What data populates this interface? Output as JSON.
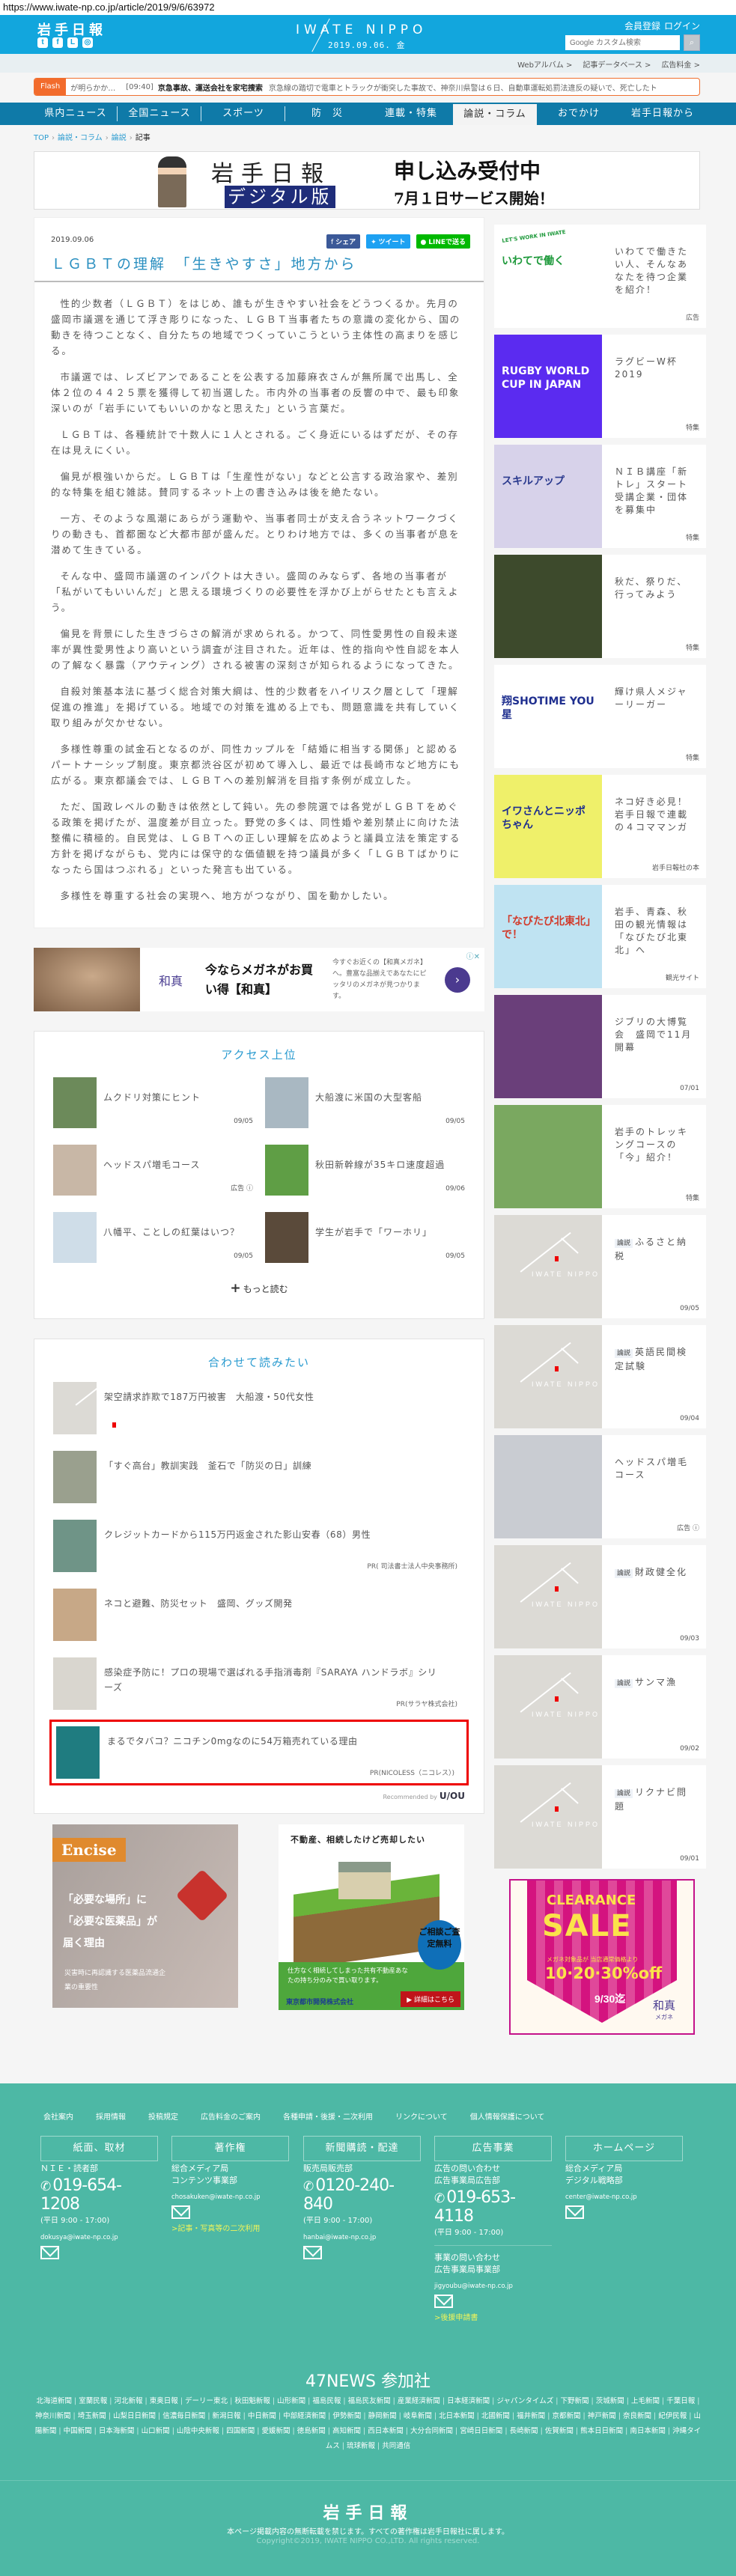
{
  "browser": {
    "url": "https://www.iwate-np.co.jp/article/2019/9/6/63972"
  },
  "header": {
    "logo": "岩手日報",
    "brand": "IWATE NIPPO",
    "date": "2019.09.06. 金",
    "register": "会員登録",
    "login": "ログイン",
    "search_placeholder": "Google カスタム検索",
    "search_icon": "magnifier",
    "social": [
      "twitter-icon",
      "facebook-icon",
      "line-icon",
      "instagram-icon"
    ],
    "sublinks": [
      "Webアルバム >",
      "記事データベース >",
      "広告料金 >"
    ]
  },
  "flash": {
    "label": "Flash",
    "prev": "が明らかか…",
    "time": "[09:40]",
    "headline": "京急事故、運送会社を家宅捜索",
    "text": "京急線の踏切で電車とトラックが衝突した事故で、神奈川県警は６日、自動車運転処罰法違反の疑いで、死亡したト"
  },
  "nav": [
    {
      "label": "県内ニュース"
    },
    {
      "label": "全国ニュース"
    },
    {
      "label": "スポーツ"
    },
    {
      "label": "防　災"
    },
    {
      "label": "連載・特集"
    },
    {
      "label": "論説・コラム",
      "active": true
    },
    {
      "label": "おでかけ"
    },
    {
      "label": "岩手日報から"
    }
  ],
  "breadcrumb": [
    "TOP",
    "論説・コラム",
    "論説",
    "記事"
  ],
  "banner": {
    "paper": "岩手日報",
    "digital": "デジタル版",
    "apply": "申し込み受付中",
    "service": "7月１日サービス開始！"
  },
  "article": {
    "date": "2019.09.06",
    "share": "シェア",
    "tweet": "ツイート",
    "line": "LINEで送る",
    "title": "ＬＧＢＴの理解　「生きやすさ」地方から",
    "paragraphs": [
      "性的少数者（ＬＧＢＴ）をはじめ、誰もが生きやすい社会をどうつくるか。先月の盛岡市議選を通じて浮き彫りになった、ＬＧＢＴ当事者たちの意識の変化から、国の動きを待つことなく、自分たちの地域でつくっていこうという主体性の高まりを感じる。",
      "市議選では、レズビアンであることを公表する加藤麻衣さんが無所属で出馬し、全体２位の４４２５票を獲得して初当選した。市内外の当事者の反響の中で、最も印象深いのが「岩手にいてもいいのかなと思えた」という言葉だ。",
      "ＬＧＢＴは、各種統計で十数人に１人とされる。ごく身近にいるはずだが、その存在は見えにくい。",
      "偏見が根強いからだ。ＬＧＢＴは「生産性がない」などと公言する政治家や、差別的な特集を組む雑誌。賛同するネット上の書き込みは後を絶たない。",
      "一方、そのような風潮にあらがう運動や、当事者同士が支え合うネットワークづくりの動きも、首都圏など大都市部が盛んだ。とりわけ地方では、多くの当事者が息を潜めて生きている。",
      "そんな中、盛岡市議選のインパクトは大きい。盛岡のみならず、各地の当事者が「私がいてもいいんだ」と思える環境づくりの必要性を浮かび上がらせたとも言えよう。",
      "偏見を背景にした生きづらさの解消が求められる。かつて、同性愛男性の自殺未遂率が異性愛男性より高いという調査が注目された。近年は、性的指向や性自認を本人の了解なく暴露（アウティング）される被害の深刻さが知られるようになってきた。",
      "自殺対策基本法に基づく総合対策大綱は、性的少数者をハイリスク層として「理解促進の推進」を掲げている。地域での対策を進める上でも、問題意識を共有していく取り組みが欠かせない。",
      "多様性尊重の試金石となるのが、同性カップルを「結婚に相当する関係」と認めるパートナーシップ制度。東京都渋谷区が初めて導入し、最近では長崎市など地方にも広がる。東京都議会では、ＬＧＢＴへの差別解消を目指す条例が成立した。",
      "ただ、国政レベルの動きは依然として鈍い。先の参院選では各党がＬＧＢＴをめぐる政策を掲げたが、温度差が目立った。野党の多くは、同性婚や差別禁止に向けた法整備に積極的。自民党は、ＬＧＢＴへの正しい理解を広めようと議員立法を策定する方針を掲げながらも、党内には保守的な価値観を持つ議員が多く「ＬＧＢＴばかりになったら国はつぶれる」といった発言も出ている。",
      "多様性を尊重する社会の実現へ、地方がつながり、国を動かしたい。"
    ]
  },
  "ad_glasses": {
    "brand": "和真",
    "headline": "今ならメガネがお買い得【和真】",
    "desc": "今すぐお近くの【和真メガネ】へ。豊富な品揃えであなたにピッタリのメガネが見つかります。",
    "go": "›",
    "adchoices": "ⓘ✕"
  },
  "ranking": {
    "title": "アクセス上位",
    "more": "もっと読む",
    "items": [
      {
        "title": "ムクドリ対策にヒント",
        "meta": "09/05",
        "thumb": "#6c8a5a"
      },
      {
        "title": "大船渡に米国の大型客船",
        "meta": "09/05",
        "thumb": "#a9b8c2"
      },
      {
        "title": "ヘッドスパ増毛コース",
        "meta": "広告 ⓘ",
        "thumb": "#c8b7a6"
      },
      {
        "title": "秋田新幹線が35キロ速度超過",
        "meta": "09/06",
        "thumb": "#5f9e45"
      },
      {
        "title": "八幡平、ことしの紅葉はいつ？",
        "meta": "09/05",
        "thumb": "#cfdde8"
      },
      {
        "title": "学生が岩手で「ワーホリ」",
        "meta": "09/05",
        "thumb": "#5a4a3a"
      }
    ]
  },
  "related": {
    "title": "合わせて読みたい",
    "recommended_by": "Recommended by",
    "recommender": "U/OU",
    "items": [
      {
        "title": "架空請求詐欺で187万円被害　大船渡・50代女性",
        "pr": "",
        "thumb": "nippo"
      },
      {
        "title": "「すぐ高台」教訓実践　釜石で「防災の日」訓練",
        "pr": "",
        "thumb": "#9aa08e"
      },
      {
        "title": "クレジットカードから115万円返金された影山安春（68）男性",
        "pr": "PR( 司法書士法人中央事務所)",
        "thumb": "#6f9487"
      },
      {
        "title": "ネコと避難、防災セット　盛岡、グッズ開発",
        "pr": "",
        "thumb": "#c7a887"
      },
      {
        "title": "感染症予防に！プロの現場で選ばれる手指消毒剤『SARAYA ハンドラボ』シリーズ",
        "pr": "PR(サラヤ株式会社)",
        "thumb": "#d9d6cf"
      },
      {
        "title": "まるでタバコ？ニコチン0mgなのに54万箱売れている理由",
        "pr": "PR(NICOLESS（ニコレス）)",
        "thumb": "#1f7c80",
        "highlight": true
      }
    ]
  },
  "ad_encise": {
    "brand": "Encise",
    "headline": "「必要な場所」に「必要な医薬品」が届く理由",
    "sub": "災害時に再認識する医薬品流通企業の重要性"
  },
  "ad_estate": {
    "headline": "不動産、相続したけど売却したい",
    "badge": "ご相談ご査定無料",
    "text": "仕方なく相続してしまった共有不動産あなたの持ち分のみで買い取ります。",
    "company": "東京都市開発株式会社",
    "cta": "▶ 詳細はこちら"
  },
  "sidebar": {
    "items": [
      {
        "title": "いわてで働きたい人、そんなあなたを待つ企業を紹介！",
        "meta": "広告",
        "img": "いわてで働く",
        "img_sub": "LET'S WORK IN IWATE",
        "bg": "#ffffff",
        "fg": "#1f9a3c"
      },
      {
        "title": "ラグビーW杯2019",
        "meta": "特集",
        "img": "RUGBY WORLD CUP IN JAPAN",
        "bg": "#5b2bf0",
        "fg": "#ffffff"
      },
      {
        "title": "ＮＩＢ講座「新トレ」スタート　受講企業・団体を募集中",
        "meta": "特集",
        "img": "スキルアップ",
        "bg": "#d7d2ea",
        "fg": "#2c3b8f"
      },
      {
        "title": "秋だ、祭りだ、行ってみよう",
        "meta": "特集",
        "bg": "#3d4a2c"
      },
      {
        "title": "輝け県人メジャーリーガー",
        "meta": "特集",
        "img": "翔SHOTIME YOU星",
        "bg": "#ffffff",
        "fg": "#1f2f8f"
      },
      {
        "title": "ネコ好き必見！岩手日報で連載の４コママンガ",
        "meta": "岩手日報社の本",
        "img": "イワさんとニッポちゃん",
        "bg": "#eff06a",
        "fg": "#1f2f8f"
      },
      {
        "title": "岩手、青森、秋田の観光情報は「なびたび北東北」へ",
        "meta": "観光サイト",
        "img": "「なびたび北東北」で！",
        "bg": "#bfe3f2",
        "fg": "#d23a2a"
      },
      {
        "title": "ジブリの大博覧会　盛岡で11月開幕",
        "meta": "07/01",
        "bg": "#6a3f7a"
      },
      {
        "title": "岩手のトレッキングコースの「今」紹介！",
        "meta": "特集",
        "bg": "#7aa860"
      },
      {
        "title": "ふるさと納税",
        "tag": "論説",
        "meta": "09/05",
        "thumb": "nippo"
      },
      {
        "title": "英語民間検定試験",
        "tag": "論説",
        "meta": "09/04",
        "thumb": "nippo"
      },
      {
        "title": "ヘッドスパ増毛コース",
        "meta": "広告 ⓘ",
        "bg": "#c9ccd2"
      },
      {
        "title": "財政健全化",
        "tag": "論説",
        "meta": "09/03",
        "thumb": "nippo"
      },
      {
        "title": "サンマ漁",
        "tag": "論説",
        "meta": "09/02",
        "thumb": "nippo"
      },
      {
        "title": "リクナビ問題",
        "tag": "論説",
        "meta": "09/01",
        "thumb": "nippo"
      }
    ],
    "nippo_ph": "IWATE NIPPO",
    "ad": {
      "l1": "CLEARANCE",
      "l2": "SALE",
      "l3": "メガネ対象品が 当店通常価格より",
      "l4": "10·20·30%off",
      "l5": "9/30迄",
      "brand": "和真",
      "brand_sub": "メガネ"
    }
  },
  "footer": {
    "links": [
      "会社案内",
      "採用情報",
      "投稿規定",
      "広告料金のご案内",
      "各種申請・後援・二次利用",
      "リンクについて",
      "個人情報保護について"
    ],
    "cols": [
      {
        "head": "紙面、取材",
        "dept": "ＮＩＥ・読者部",
        "tel": "019-654-1208",
        "hours": "(平日 9:00 - 17:00)",
        "mail": "dokusya@iwate-np.co.jp"
      },
      {
        "head": "著作権",
        "dept": "総合メディア局\nコンテンツ事業部",
        "mail": "chosakuken@iwate-np.co.jp",
        "link": ">記事・写真等の二次利用"
      },
      {
        "head": "新聞購読・配達",
        "dept": "販売局販売部",
        "tel": "0120-240-840",
        "hours": "(平日 9:00 - 17:00)",
        "mail": "hanbai@iwate-np.co.jp"
      },
      {
        "head": "広告事業",
        "dept": "広告の問い合わせ\n広告事業局広告部",
        "tel": "019-653-4118",
        "hours": "(平日 9:00 - 17:00)",
        "dept2": "事業の問い合わせ\n広告事業局事業部",
        "mail": "jigyoubu@iwate-np.co.jp",
        "link": ">後援申請書"
      },
      {
        "head": "ホームページ",
        "dept": "総合メディア局\nデジタル戦略部",
        "mail": "center@iwate-np.co.jp"
      }
    ],
    "n47_title": "47NEWS 参加社",
    "papers": [
      "北海道新聞",
      "室蘭民報",
      "河北新報",
      "東奥日報",
      "デーリー東北",
      "秋田魁新報",
      "山形新聞",
      "福島民報",
      "福島民友新聞",
      "産業経済新聞",
      "日本経済新聞",
      "ジャパンタイムズ",
      "下野新聞",
      "茨城新聞",
      "上毛新聞",
      "千葉日報",
      "神奈川新聞",
      "埼玉新聞",
      "山梨日日新聞",
      "信濃毎日新聞",
      "新潟日報",
      "中日新聞",
      "中部経済新聞",
      "伊勢新聞",
      "静岡新聞",
      "岐阜新聞",
      "北日本新聞",
      "北國新聞",
      "福井新聞",
      "京都新聞",
      "神戸新聞",
      "奈良新聞",
      "紀伊民報",
      "山陽新聞",
      "中国新聞",
      "日本海新聞",
      "山口新聞",
      "山陰中央新報",
      "四国新聞",
      "愛媛新聞",
      "徳島新聞",
      "高知新聞",
      "西日本新聞",
      "大分合同新聞",
      "宮崎日日新聞",
      "長崎新聞",
      "佐賀新聞",
      "熊本日日新聞",
      "南日本新聞",
      "沖縄タイムス",
      "琉球新報",
      "共同通信"
    ],
    "logo": "岩手日報",
    "notice": "本ページ掲載内容の無断転載を禁じます。すべての著作権は岩手日報社に属します。",
    "copyright": "Copyright©2019, IWATE NIPPO CO.,LTD. All rights reserved."
  }
}
